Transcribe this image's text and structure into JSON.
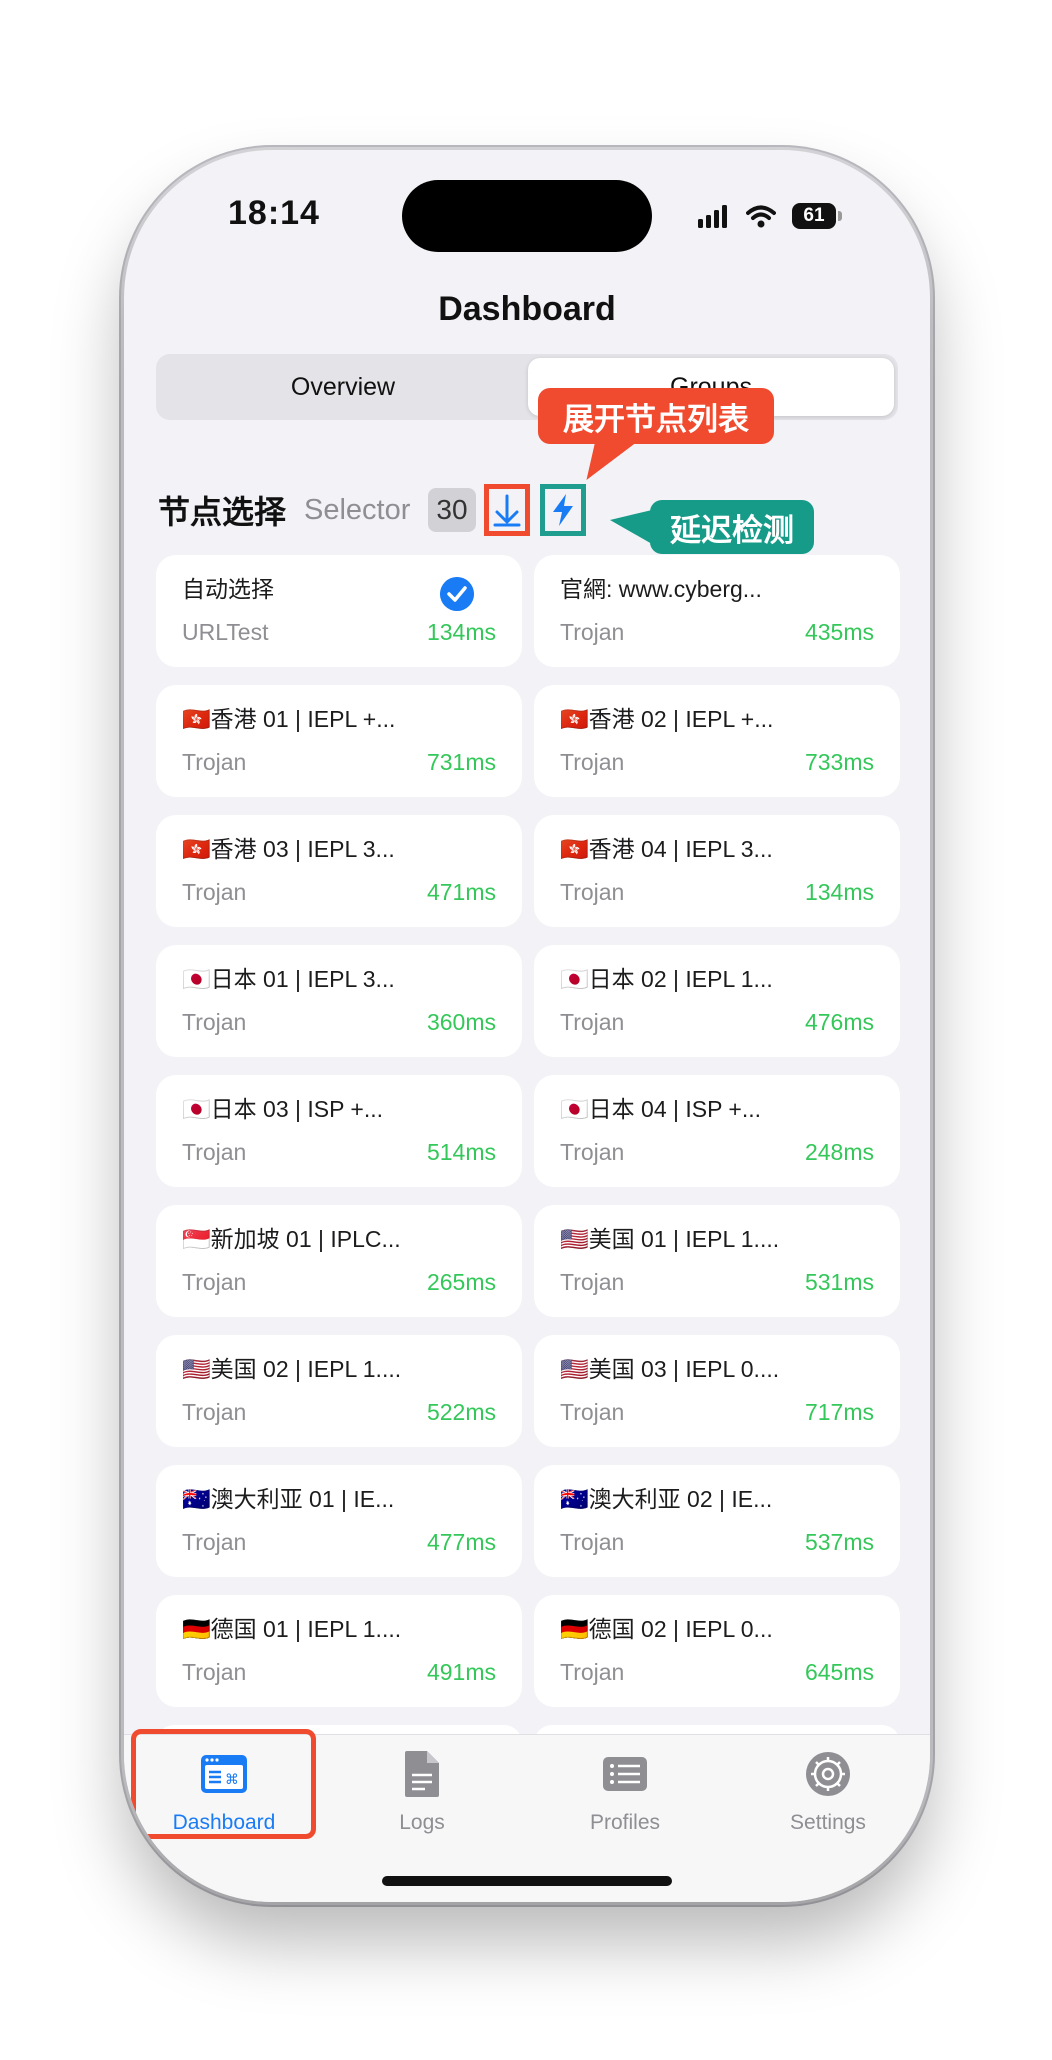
{
  "status_bar": {
    "time": "18:14",
    "battery": "61"
  },
  "nav": {
    "title": "Dashboard"
  },
  "segments": {
    "overview": "Overview",
    "groups": "Groups"
  },
  "group": {
    "name": "节点选择",
    "type": "Selector",
    "count": "30"
  },
  "callouts": {
    "expand": "展开节点列表",
    "latency": "延迟检测"
  },
  "nodes": [
    {
      "name": "自动选择",
      "type": "URLTest",
      "delay": "134ms",
      "selected": true
    },
    {
      "name": "官網: www.cyberg...",
      "type": "Trojan",
      "delay": "435ms"
    },
    {
      "name": "🇭🇰香港 01 | IEPL +...",
      "type": "Trojan",
      "delay": "731ms"
    },
    {
      "name": "🇭🇰香港 02 | IEPL +...",
      "type": "Trojan",
      "delay": "733ms"
    },
    {
      "name": "🇭🇰香港 03 | IEPL 3...",
      "type": "Trojan",
      "delay": "471ms"
    },
    {
      "name": "🇭🇰香港 04 | IEPL 3...",
      "type": "Trojan",
      "delay": "134ms"
    },
    {
      "name": "🇯🇵日本 01 | IEPL 3...",
      "type": "Trojan",
      "delay": "360ms"
    },
    {
      "name": "🇯🇵日本 02 | IEPL 1...",
      "type": "Trojan",
      "delay": "476ms"
    },
    {
      "name": "🇯🇵日本 03 | ISP +...",
      "type": "Trojan",
      "delay": "514ms"
    },
    {
      "name": "🇯🇵日本 04 | ISP +...",
      "type": "Trojan",
      "delay": "248ms"
    },
    {
      "name": "🇸🇬新加坡 01 | IPLC...",
      "type": "Trojan",
      "delay": "265ms"
    },
    {
      "name": "🇺🇸美国 01 | IEPL 1....",
      "type": "Trojan",
      "delay": "531ms"
    },
    {
      "name": "🇺🇸美国 02 | IEPL 1....",
      "type": "Trojan",
      "delay": "522ms"
    },
    {
      "name": "🇺🇸美国 03 | IEPL 0....",
      "type": "Trojan",
      "delay": "717ms"
    },
    {
      "name": "🇦🇺澳大利亚 01 | IE...",
      "type": "Trojan",
      "delay": "477ms"
    },
    {
      "name": "🇦🇺澳大利亚 02 | IE...",
      "type": "Trojan",
      "delay": "537ms"
    },
    {
      "name": "🇩🇪德国 01 | IEPL 1....",
      "type": "Trojan",
      "delay": "491ms"
    },
    {
      "name": "🇩🇪德国 02 | IEPL 0...",
      "type": "Trojan",
      "delay": "645ms"
    }
  ],
  "tabs": [
    {
      "label": "Dashboard",
      "icon": "dashboard-icon",
      "active": true
    },
    {
      "label": "Logs",
      "icon": "document-icon"
    },
    {
      "label": "Profiles",
      "icon": "list-icon"
    },
    {
      "label": "Settings",
      "icon": "gear-icon"
    }
  ],
  "colors": {
    "accent": "#1a7cf5",
    "delay": "#34c759",
    "highlight_red": "#f04a2f",
    "highlight_teal": "#159b88"
  }
}
